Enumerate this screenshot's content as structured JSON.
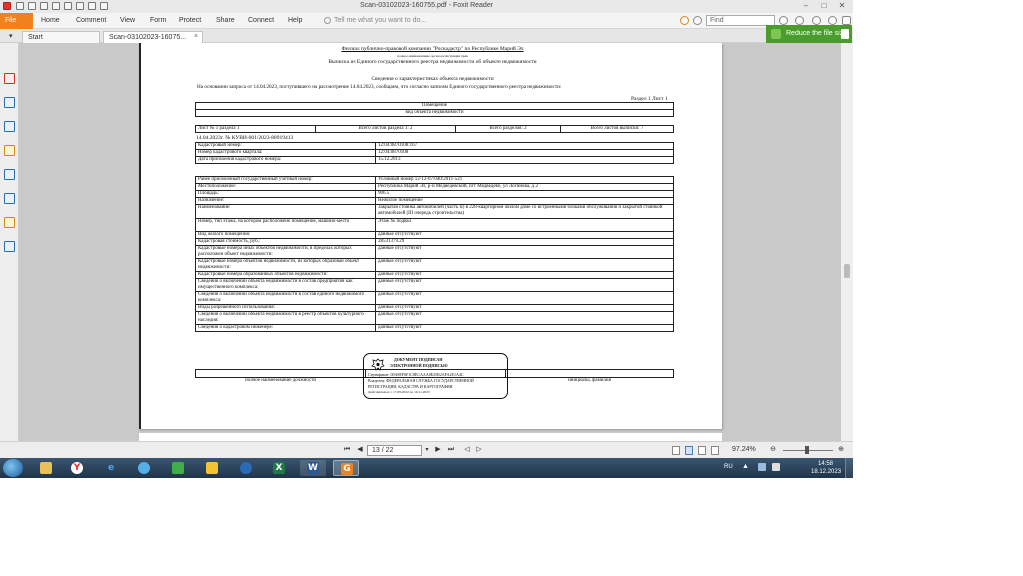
{
  "window": {
    "title": "Scan-03102023-160755.pdf - Foxit Reader"
  },
  "ribbon": {
    "file_tab": "File",
    "tabs": [
      "Home",
      "Comment",
      "View",
      "Form",
      "Protect",
      "Share",
      "Connect",
      "Help"
    ],
    "tell_me_placeholder": "Tell me what you want to do...",
    "find_placeholder": "Find"
  },
  "doc_tabs": {
    "start": "Start",
    "current": "Scan-03102023-16075...",
    "close": "×"
  },
  "reduce_button": "Reduce the file size",
  "document": {
    "header_line1": "Филиал публично-правовой компании \"Роскадастр\" по Республике Марий Эл",
    "header_line2": "полное наименование органа регистрации прав",
    "header_line3": "Выписка из Единого государственного реестра недвижимости об объекте недвижимости",
    "section_title": "Сведения о характеристиках объекта недвижимости",
    "request_line": "На основании запроса от 14.04.2023, поступившего на рассмотрение 14.04.2023, сообщаем, что согласно записям Единого государственного реестра недвижимости:",
    "section_label": "Раздел 1 Лист 1",
    "object_type": "Помещение",
    "object_type_caption": "вид объекта недвижимости",
    "sheet_row": [
      "Лист № 1 раздела 1",
      "Всего листов раздела 1: 2",
      "Всего разделов: 2",
      "Всего листов выписки: 7"
    ],
    "doc_number": "14.04.2023г. № КУВИ-001/2023-88919413",
    "top_rows": [
      [
        "Кадастровый номер:",
        "12:04:0870108:167"
      ],
      [
        "Номер кадастрового квартала:",
        "12:04:0870108"
      ],
      [
        "Дата присвоения кадастрового номера:",
        "15.12.2013"
      ]
    ],
    "main_rows": [
      [
        "Ранее присвоенный государственный учетный номер:",
        "Условный номер 12-12-07/040/2011-521"
      ],
      [
        "Местоположение:",
        "Республика Марий Эл, р-н Медведевский, пгт Медведево, ул Логинова, д 2"
      ],
      [
        "Площадь:",
        "906.5"
      ],
      [
        "Назначение:",
        "Нежилое помещение"
      ],
      [
        "Наименование:",
        "Закрытая стоянка автомобилей (часть II) в 228-квартирном жилом доме со встроенными блоками обслуживания и закрытой стоянкой автомобилей (III очередь строительства)"
      ],
      [
        "Номер, тип этажа, на котором расположено помещение, машино-место",
        "Этаж № подвал"
      ],
      [
        "Вид жилого помещения:",
        "данные отсутствуют"
      ],
      [
        "Кадастровая стоимость, руб.:",
        "28531379.29"
      ],
      [
        "Кадастровые номера иных объектов недвижимости, в пределах которых расположен объект недвижимости:",
        "данные отсутствуют"
      ],
      [
        "Кадастровые номера объектов недвижимости, из которых образован объект недвижимости:",
        "данные отсутствуют"
      ],
      [
        "Кадастровые номера образованных объектов недвижимости:",
        "данные отсутствуют"
      ],
      [
        "Сведения о включении объекта недвижимости в состав предприятия как имущественного комплекса:",
        "данные отсутствуют"
      ],
      [
        "Сведения о включении объекта недвижимости в состав единого недвижимого комплекса:",
        "данные отсутствуют"
      ],
      [
        "Виды разрешенного использования:",
        "данные отсутствуют"
      ],
      [
        "Сведения о включении объекта недвижимости в реестр объектов культурного наследия:",
        "данные отсутствуют"
      ],
      [
        "Сведения о кадастровом инженере:",
        "данные отсутствуют"
      ]
    ],
    "signature_left": "полное наименование должности",
    "signature_right": "инициалы, фамилия",
    "stamp": {
      "line1": "ДОКУМЕНТ ПОДПИСАН",
      "line2": "ЭЛЕКТРОННОЙ ПОДПИСЬЮ",
      "line3": "Сертификат: 00A8EF6F1C8ECAAA0E25B2AFA2E1A4C",
      "line4": "Владелец: ФЕДЕРАЛЬНАЯ СЛУЖБА ГОСУДАРСТВЕННОЙ",
      "line5": "РЕГИСТРАЦИИ, КАДАСТРА И КАРТОГРАФИИ",
      "line6": "Действителен: с 17.08.2022 по 10.11.2023"
    }
  },
  "navbar": {
    "page_indicator": "13 / 22",
    "zoom": "97.24%"
  },
  "taskbar": {
    "language": "RU",
    "time": "14:58",
    "date": "18.12.2023"
  },
  "colors": {
    "file_tab": "#f0821e",
    "reduce_button": "#4a9d2c",
    "taskbar": "#2b4660"
  }
}
